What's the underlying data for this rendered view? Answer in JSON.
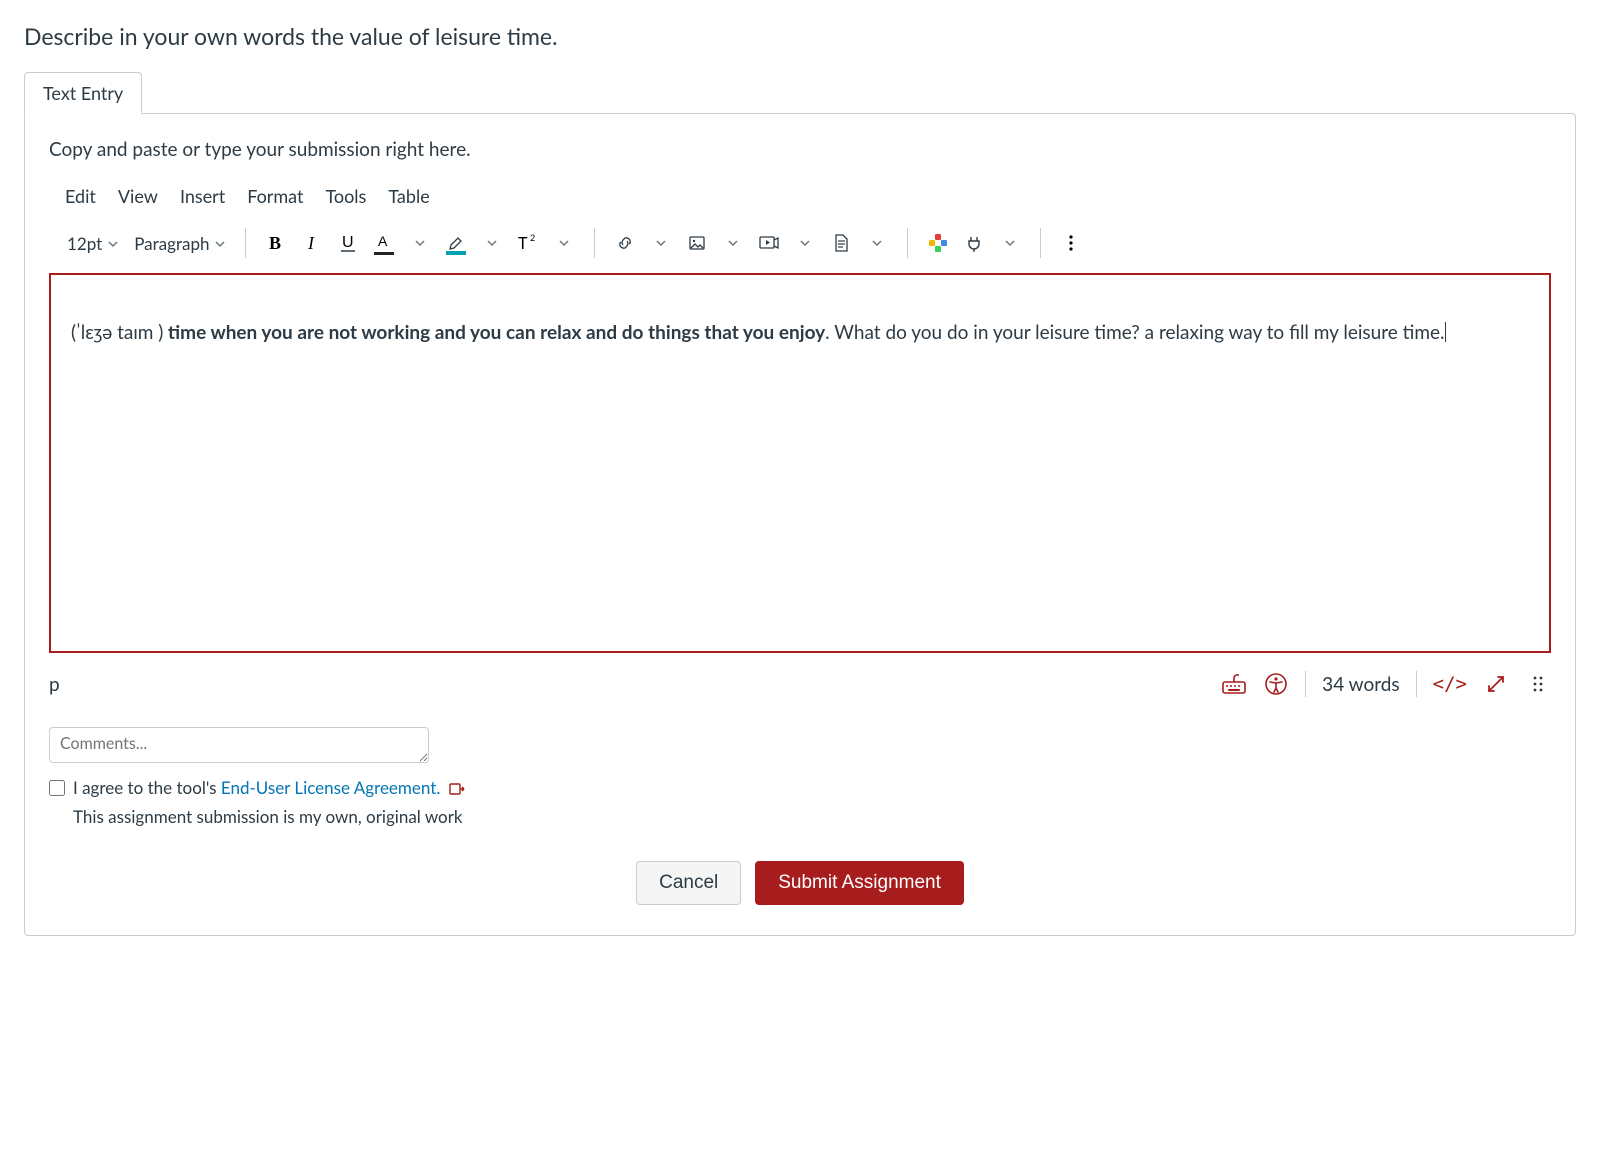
{
  "assignment_title": "Describe in your own words the value of leisure time.",
  "tab_label": "Text Entry",
  "instructions": "Copy and paste or type your submission right here.",
  "menu": {
    "edit": "Edit",
    "view": "View",
    "insert": "Insert",
    "format": "Format",
    "tools": "Tools",
    "table": "Table"
  },
  "toolbar": {
    "font_size": "12pt",
    "block_format": "Paragraph"
  },
  "editor_content": {
    "phonetic_open": "(",
    "phonetic": "ˈlɛʒə taɪm",
    "phonetic_close": " )",
    "bold_part": " time when you are not working and you can relax and do things that you enjoy",
    "plain_part": ". What do you do in your leisure time? a relaxing way to fill my leisure time."
  },
  "status": {
    "path": "p",
    "word_count": "34 words",
    "code_toggle": "</>"
  },
  "comments_placeholder": "Comments...",
  "agreement": {
    "prefix": "I agree to the tool's ",
    "link_text": "End-User License Agreement.",
    "own_work": "This assignment submission is my own, original work"
  },
  "buttons": {
    "cancel": "Cancel",
    "submit": "Submit Assignment"
  }
}
